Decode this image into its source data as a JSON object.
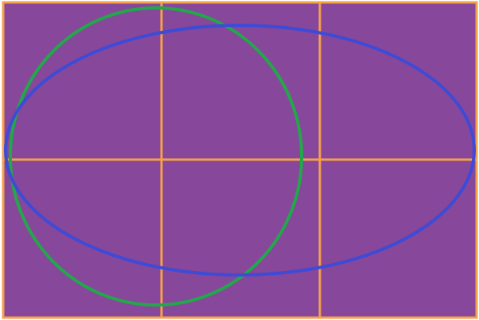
{
  "colors": {
    "background": "#FFFFFF",
    "panel_fill": "#87479A",
    "grid_line": "#F6A04A",
    "circle_stroke": "#22A84A",
    "ellipse_stroke": "#3D4BD6"
  },
  "grid": {
    "columns": 3,
    "rows": 2
  },
  "shapes": [
    {
      "kind": "circle",
      "color_key": "circle_stroke"
    },
    {
      "kind": "ellipse",
      "color_key": "ellipse_stroke"
    }
  ]
}
